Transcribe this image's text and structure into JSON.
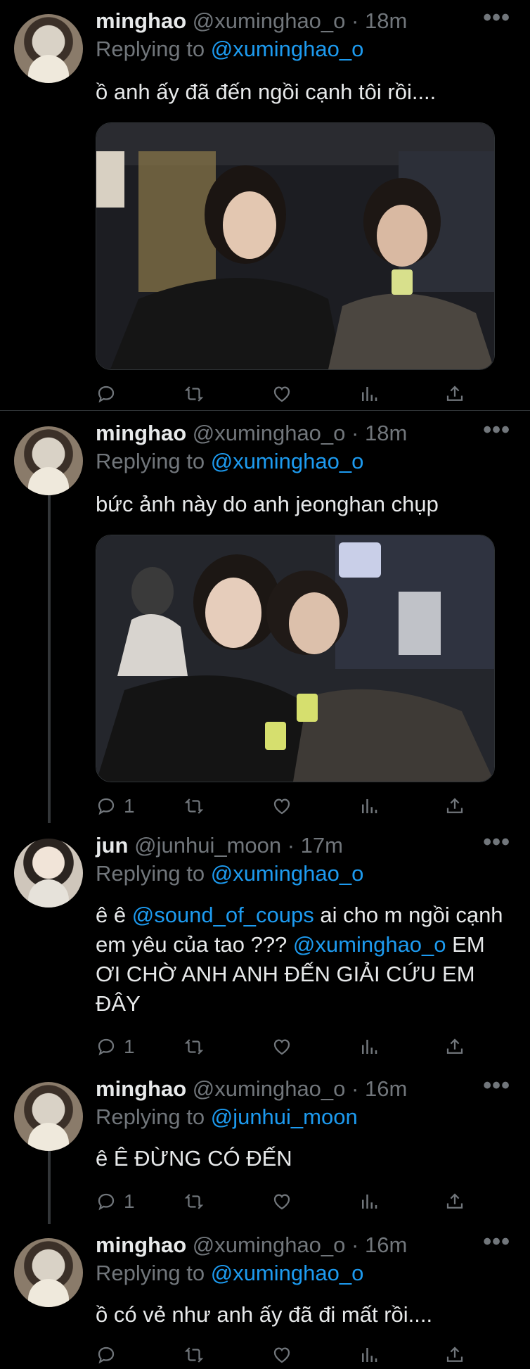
{
  "tweets": [
    {
      "name": "minghao",
      "handle": "@xuminghao_o",
      "time": "· 18m",
      "replying_prefix": "Replying to",
      "replying_to": "@xuminghao_o",
      "text": "ồ anh ấy đã đến ngồi cạnh tôi rồi....",
      "reply_count": "",
      "more": "•••"
    },
    {
      "name": "minghao",
      "handle": "@xuminghao_o",
      "time": "· 18m",
      "replying_prefix": "Replying to",
      "replying_to": "@xuminghao_o",
      "text": "bức ảnh này do anh jeonghan chụp",
      "reply_count": "1",
      "more": "•••"
    },
    {
      "name": "jun",
      "handle": "@junhui_moon",
      "time": "· 17m",
      "replying_prefix": "Replying to",
      "replying_to": "@xuminghao_o",
      "text_parts": {
        "p1": "ê ê ",
        "mention1": "@sound_of_coups",
        "p2": " ai cho m ngồi cạnh em yêu của tao ??? ",
        "mention2": "@xuminghao_o",
        "p3": " EM ƠI CHỜ ANH ANH ĐẾN GIẢI CỨU EM ĐÂY"
      },
      "reply_count": "1",
      "more": "•••"
    },
    {
      "name": "minghao",
      "handle": "@xuminghao_o",
      "time": "· 16m",
      "replying_prefix": "Replying to",
      "replying_to": "@junhui_moon",
      "text": "ê Ê ĐỪNG CÓ ĐẾN",
      "reply_count": "1",
      "more": "•••"
    },
    {
      "name": "minghao",
      "handle": "@xuminghao_o",
      "time": "· 16m",
      "replying_prefix": "Replying to",
      "replying_to": "@xuminghao_o",
      "text": "ồ có vẻ như anh ấy đã đi mất rồi....",
      "reply_count": "",
      "more": "•••"
    }
  ],
  "icons": [
    "reply-icon",
    "retweet-icon",
    "like-icon",
    "analytics-icon",
    "share-icon"
  ],
  "colors": {
    "background": "#000000",
    "text": "#e7e9ea",
    "muted": "#71767b",
    "link": "#1d9bf0"
  }
}
